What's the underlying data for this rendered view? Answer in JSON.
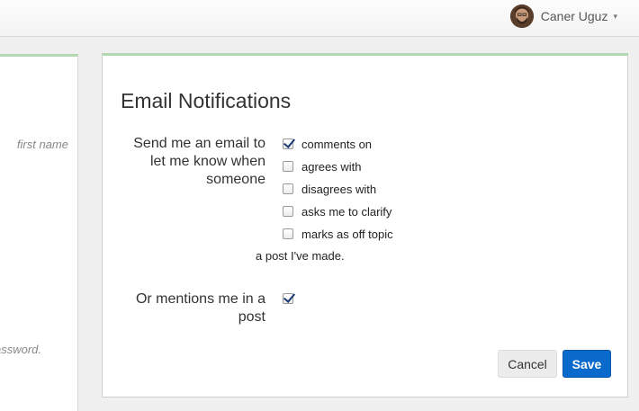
{
  "header": {
    "user_name": "Caner Uguz",
    "caret_icon": "▾"
  },
  "left_panel": {
    "hint_first_name": "first name",
    "hint_password": "assword."
  },
  "notifications": {
    "title": "Email Notifications",
    "send_label": "Send me an email to let me know when someone",
    "options": [
      {
        "label": "comments on",
        "checked": true
      },
      {
        "label": "agrees with",
        "checked": false
      },
      {
        "label": "disagrees with",
        "checked": false
      },
      {
        "label": "asks me to clarify",
        "checked": false
      },
      {
        "label": "marks as off topic",
        "checked": false
      }
    ],
    "suffix": "a post I've made.",
    "mentions_label": "Or mentions me in a post",
    "mentions_checked": true,
    "cancel_label": "Cancel",
    "save_label": "Save"
  },
  "colors": {
    "accent_green": "#b3d9b3",
    "save_blue": "#0a6acb",
    "check_navy": "#1b3c78"
  }
}
